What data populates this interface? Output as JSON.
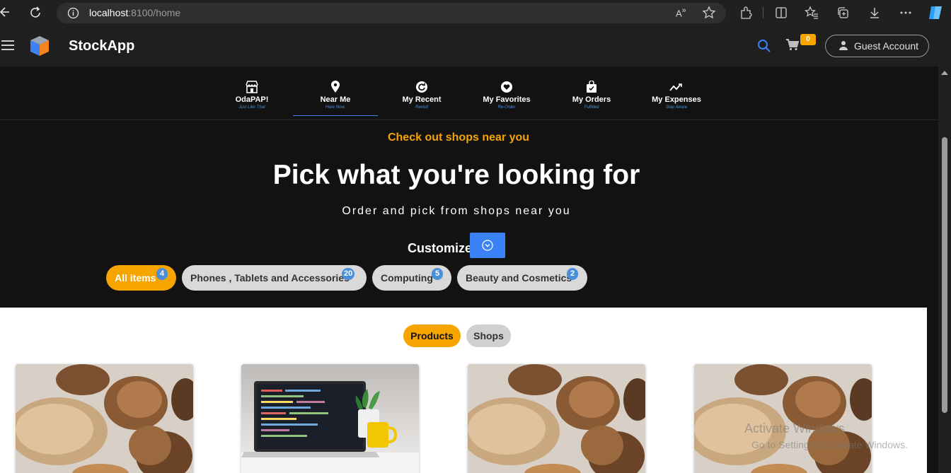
{
  "browser": {
    "url_host": "localhost",
    "url_rest": ":8100/home"
  },
  "app": {
    "title": "StockApp",
    "cart_count": "0",
    "account_label": "Guest Account"
  },
  "categories": [
    {
      "label": "OdaPAP!",
      "sub": "Just Like That",
      "icon": "storefront-icon"
    },
    {
      "label": "Near Me",
      "sub": "Here Now.",
      "icon": "location-pin-icon"
    },
    {
      "label": "My Recent",
      "sub": "Revisit",
      "icon": "recent-icon"
    },
    {
      "label": "My Favorites",
      "sub": "Re-Order",
      "icon": "heart-icon"
    },
    {
      "label": "My Orders",
      "sub": "Fulfilled",
      "icon": "shopping-bag-icon"
    },
    {
      "label": "My Expenses",
      "sub": "Stay Aware",
      "icon": "trend-icon"
    }
  ],
  "hero": {
    "kicker": "Check out shops near you",
    "title": "Pick what you're looking for",
    "subtitle": "Order and pick from shops near you",
    "customize_label": "Customize"
  },
  "filters": [
    {
      "label": "All items",
      "count": "4",
      "active": true
    },
    {
      "label": "Phones , Tablets and Accessories",
      "count": "20",
      "active": false
    },
    {
      "label": "Computing",
      "count": "5",
      "active": false
    },
    {
      "label": "Beauty and Cosmetics",
      "count": "2",
      "active": false
    }
  ],
  "segments": {
    "products": "Products",
    "shops": "Shops"
  },
  "watermark": {
    "title": "Activate Windows",
    "subtitle": "Go to Settings to activate Windows."
  },
  "colors": {
    "accent_orange": "#f5a400",
    "accent_blue": "#3b82f6",
    "badge_blue": "#4a90d9"
  }
}
